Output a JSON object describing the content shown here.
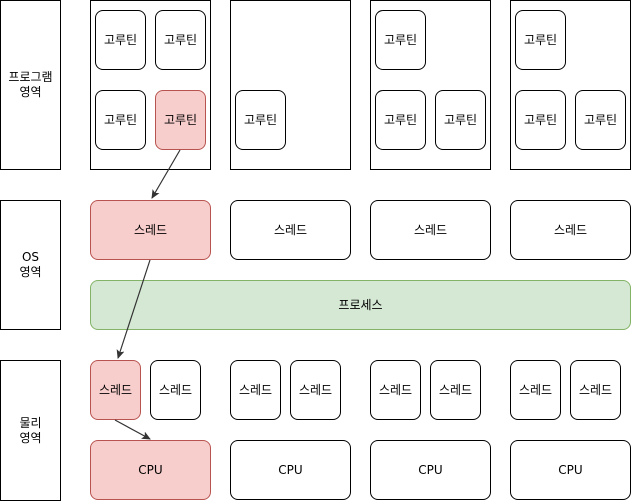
{
  "layers": {
    "program": "프로그램\n영역",
    "os": "OS\n영역",
    "physical": "물리\n영역"
  },
  "coroutine": "고루틴",
  "thread": "스레드",
  "process": "프로세스",
  "cpu": "CPU",
  "colors": {
    "highlight_fill": "#f8cecc",
    "highlight_stroke": "#b85450",
    "process_fill": "#d5e8d4",
    "process_stroke": "#82b366"
  }
}
